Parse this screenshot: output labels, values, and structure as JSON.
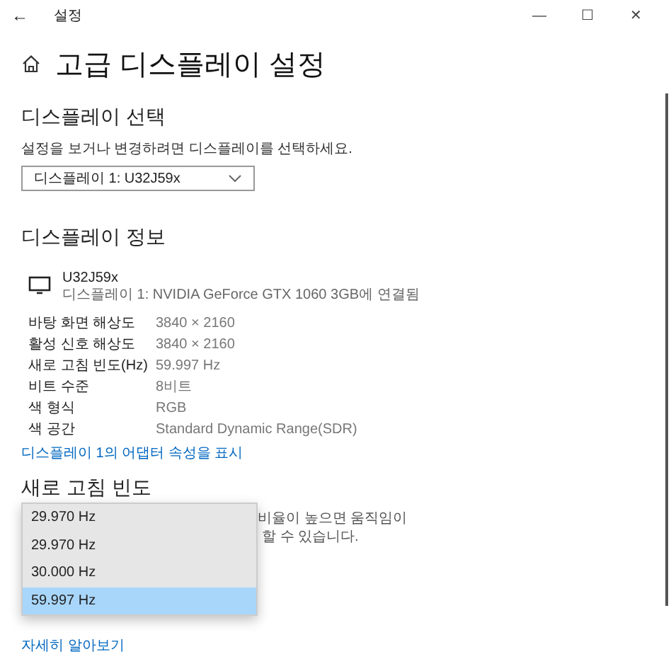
{
  "window": {
    "title": "설정",
    "back": "←",
    "minimize": "—",
    "maximize": "☐",
    "close": "✕"
  },
  "page_title": "고급 디스플레이 설정",
  "display_select": {
    "heading": "디스플레이 선택",
    "description": "설정을 보거나 변경하려면 디스플레이를 선택하세요.",
    "dropdown_value": "디스플레이 1: U32J59x"
  },
  "display_info": {
    "heading": "디스플레이 정보",
    "monitor_name": "U32J59x",
    "monitor_subtitle": "디스플레이 1: NVIDIA GeForce GTX 1060 3GB에 연결됨",
    "rows": [
      {
        "label": "바탕 화면 해상도",
        "value": "3840 × 2160"
      },
      {
        "label": "활성 신호 해상도",
        "value": "3840 × 2160"
      },
      {
        "label": "새로 고침 빈도(Hz)",
        "value": "59.997 Hz"
      },
      {
        "label": "비트 수준",
        "value": "8비트"
      },
      {
        "label": "색 형식",
        "value": "RGB"
      },
      {
        "label": "색 공간",
        "value": "Standard Dynamic Range(SDR)"
      }
    ],
    "adapter_link": "디스플레이 1의 어댑터 속성을 표시"
  },
  "refresh_rate": {
    "heading": "새로 고침 빈도",
    "description_lines": [
      "비율이 높으면 움직임이",
      "할 수 있습니다."
    ],
    "options": [
      {
        "label": "29.970 Hz",
        "selected": false
      },
      {
        "label": "29.970 Hz",
        "selected": false
      },
      {
        "label": "30.000 Hz",
        "selected": false
      },
      {
        "label": "59.997 Hz",
        "selected": true
      }
    ],
    "learn_more_link": "자세히 알아보기"
  }
}
